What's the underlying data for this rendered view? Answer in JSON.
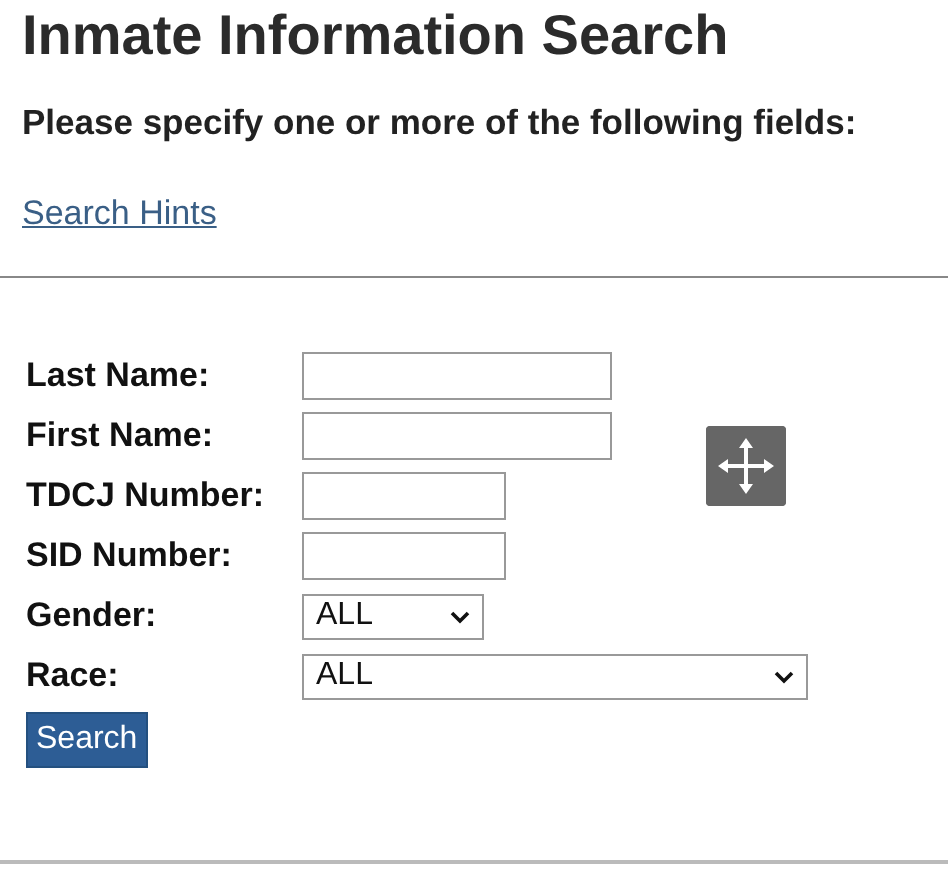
{
  "title": "Inmate Information Search",
  "instructions": "Please specify one or more of the following fields:",
  "hints_link": "Search Hints",
  "fields": [
    {
      "label": "Last Name:",
      "kind": "text"
    },
    {
      "label": "First Name:",
      "kind": "text"
    },
    {
      "label": "TDCJ Number:",
      "kind": "text"
    },
    {
      "label": "SID Number:",
      "kind": "text"
    },
    {
      "label": "Gender:",
      "kind": "select",
      "value": "ALL"
    },
    {
      "label": "Race:",
      "kind": "select",
      "value": "ALL"
    }
  ],
  "submit": "Search"
}
